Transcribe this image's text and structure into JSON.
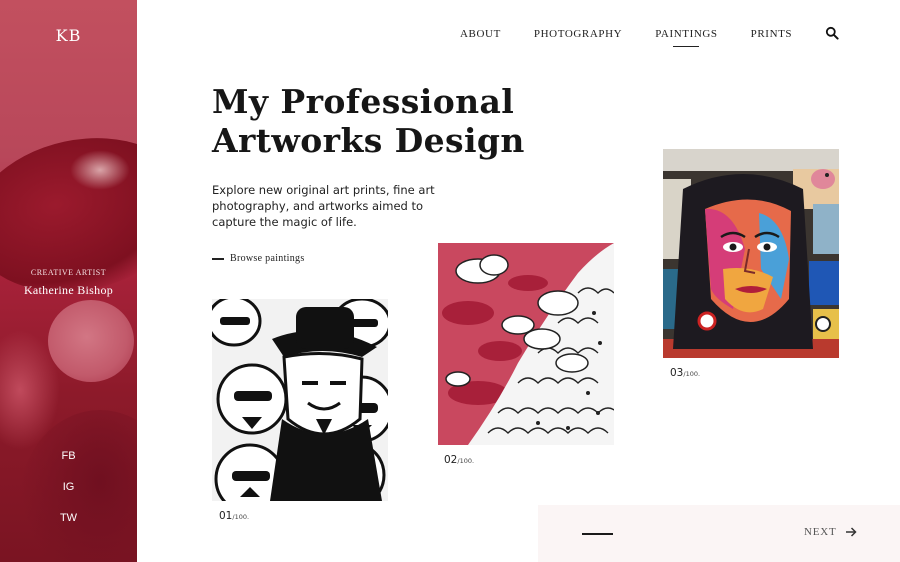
{
  "sidebar": {
    "logo": "KB",
    "artist_role": "CREATIVE ARTIST",
    "artist_name": "Katherine Bishop",
    "social": [
      "FB",
      "IG",
      "TW"
    ]
  },
  "nav": {
    "items": [
      {
        "label": "ABOUT"
      },
      {
        "label": "PHOTOGRAPHY"
      },
      {
        "label": "PAINTINGS",
        "active": true
      },
      {
        "label": "PRINTS"
      }
    ],
    "search_icon": "search-icon"
  },
  "hero": {
    "title_line1": "My Professional",
    "title_line2": "Artworks Design",
    "intro": "Explore new original art prints, fine art photography, and artworks aimed to capture the magic of life.",
    "browse_label": "Browse paintings"
  },
  "artworks": [
    {
      "number": "01",
      "total": "/100."
    },
    {
      "number": "02",
      "total": "/100."
    },
    {
      "number": "03",
      "total": "/100."
    }
  ],
  "pager": {
    "next_label": "NEXT",
    "next_icon": "arrow-right-icon"
  },
  "colors": {
    "sidebar_top": "#c2505f",
    "sidebar_bottom": "#7a1422",
    "pager_bg": "#fbf5f5",
    "text": "#1a1a1a"
  }
}
